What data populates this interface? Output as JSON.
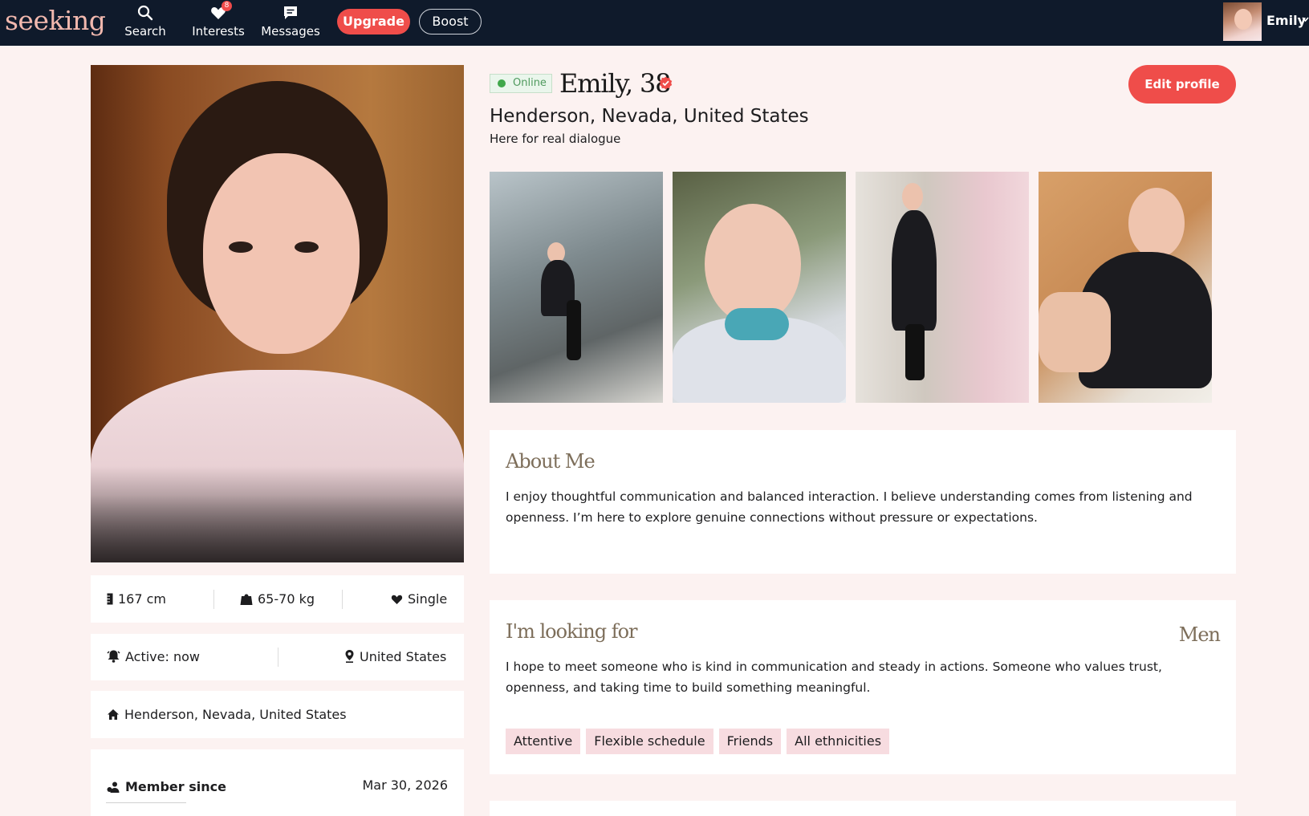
{
  "nav": {
    "logo": "seeking",
    "search_label": "Search",
    "interests_label": "Interests",
    "interests_badge": "8",
    "messages_label": "Messages",
    "upgrade_label": "Upgrade",
    "boost_label": "Boost",
    "user_name": "Emily"
  },
  "profile": {
    "status": "Online",
    "name_age": "Emily, 38",
    "location": "Henderson, Nevada, United States",
    "tagline": "Here for real dialogue",
    "edit_label": "Edit profile"
  },
  "stats": {
    "height": "167 cm",
    "weight": "65-70 kg",
    "relationship": "Single",
    "active": "Active: now",
    "country": "United States",
    "home": "Henderson, Nevada, United States",
    "member_since_label": "Member since",
    "member_since_date": "Mar 30, 2026"
  },
  "about": {
    "title": "About Me",
    "text": "I enjoy thoughtful communication and balanced interaction. I believe understanding comes from listening and openness. I’m here to explore genuine connections without pressure or expectations."
  },
  "looking": {
    "title": "I'm looking for",
    "target": "Men",
    "text": "I hope to meet someone who is kind in communication and steady in actions. Someone who values trust, openness, and taking time to build something meaningful.",
    "tags": [
      "Attentive",
      "Flexible schedule",
      "Friends",
      "All ethnicities"
    ]
  },
  "colors": {
    "nav_bg": "#0f1a2b",
    "accent": "#ef4d4a",
    "page_bg": "#fcf2f1",
    "section_title": "#7d6e5a",
    "tag_bg": "#f7dce0",
    "online_green": "#40a84b"
  }
}
